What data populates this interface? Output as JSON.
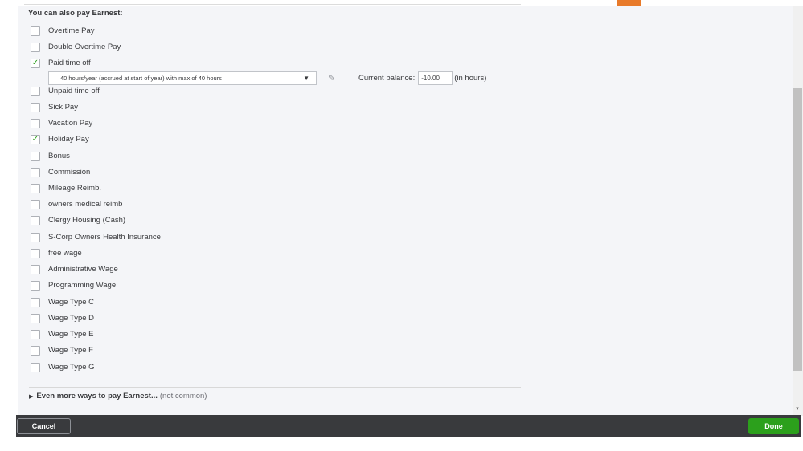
{
  "section": {
    "heading": "You can also pay Earnest:"
  },
  "pay_types": [
    {
      "label": "Overtime Pay",
      "checked": false
    },
    {
      "label": "Double Overtime Pay",
      "checked": false
    },
    {
      "label": "Paid time off",
      "checked": true
    },
    {
      "label": "Unpaid time off",
      "checked": false
    },
    {
      "label": "Sick Pay",
      "checked": false
    },
    {
      "label": "Vacation Pay",
      "checked": false
    },
    {
      "label": "Holiday Pay",
      "checked": true
    },
    {
      "label": "Bonus",
      "checked": false
    },
    {
      "label": "Commission",
      "checked": false
    },
    {
      "label": "Mileage Reimb.",
      "checked": false
    },
    {
      "label": "owners medical reimb",
      "checked": false
    },
    {
      "label": "Clergy Housing (Cash)",
      "checked": false
    },
    {
      "label": "S-Corp Owners Health Insurance",
      "checked": false
    },
    {
      "label": "free wage",
      "checked": false
    },
    {
      "label": "Administrative Wage",
      "checked": false
    },
    {
      "label": "Programming Wage",
      "checked": false
    },
    {
      "label": "Wage Type C",
      "checked": false
    },
    {
      "label": "Wage Type D",
      "checked": false
    },
    {
      "label": "Wage Type E",
      "checked": false
    },
    {
      "label": "Wage Type F",
      "checked": false
    },
    {
      "label": "Wage Type G",
      "checked": false
    }
  ],
  "pto": {
    "policy_selected": "40 hours/year (accrued at start of year) with max of 40 hours",
    "balance_label": "Current balance:",
    "balance_value": "-10.00",
    "balance_unit": "(in hours)"
  },
  "more": {
    "label_bold": "Even more ways to pay Earnest...",
    "label_light": "(not common)"
  },
  "footer": {
    "cancel_label": "Cancel",
    "done_label": "Done"
  },
  "colors": {
    "accent_green": "#2ca01c",
    "footer_dark": "#393a3d",
    "orange_tab": "#e87a2a"
  },
  "icons": {
    "check": "checkmark-icon",
    "edit": "pencil-icon",
    "caret": "caret-down-icon",
    "expand": "triangle-right-icon"
  }
}
